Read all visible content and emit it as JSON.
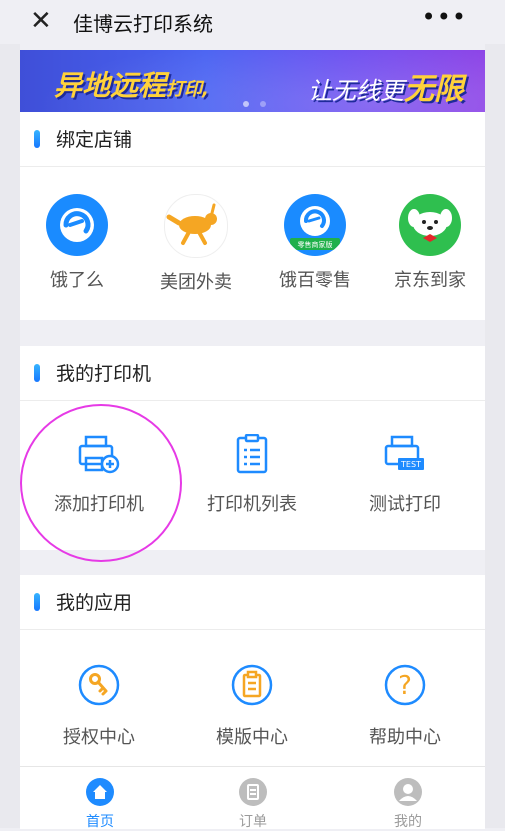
{
  "header": {
    "close_icon": "close-icon",
    "title": "佳博云打印系统",
    "more_icon": "more-icon"
  },
  "banner": {
    "left_big": "异地远程",
    "left_small": "打印,",
    "right_text": "让无线更",
    "right_big": "无限"
  },
  "shops": {
    "title": "绑定店铺",
    "items": [
      {
        "label": "饿了么",
        "icon": "eleme-icon",
        "color": "#1a8bff"
      },
      {
        "label": "美团外卖",
        "icon": "kangaroo-icon",
        "color": "#f5a623"
      },
      {
        "label": "饿百零售",
        "icon": "ebai-icon",
        "color": "#1a8bff",
        "subtext": "零售商家版"
      },
      {
        "label": "京东到家",
        "icon": "jd-dog-icon",
        "color": "#2fbf4f"
      }
    ]
  },
  "printers": {
    "title": "我的打印机",
    "items": [
      {
        "label": "添加打印机",
        "icon": "add-printer-icon"
      },
      {
        "label": "打印机列表",
        "icon": "printer-list-icon"
      },
      {
        "label": "测试打印",
        "icon": "test-print-icon",
        "badge": "TEST"
      }
    ]
  },
  "apps": {
    "title": "我的应用",
    "items": [
      {
        "label": "授权中心",
        "icon": "key-icon"
      },
      {
        "label": "模版中心",
        "icon": "template-icon"
      },
      {
        "label": "帮助中心",
        "icon": "help-icon",
        "glyph": "?"
      }
    ]
  },
  "tabbar": {
    "items": [
      {
        "label": "首页",
        "icon": "home-icon",
        "active": true
      },
      {
        "label": "订单",
        "icon": "order-icon",
        "active": false
      },
      {
        "label": "我的",
        "icon": "profile-icon",
        "active": false
      }
    ]
  },
  "colors": {
    "accent": "#1e8bff",
    "highlight": "#e63ae6"
  }
}
